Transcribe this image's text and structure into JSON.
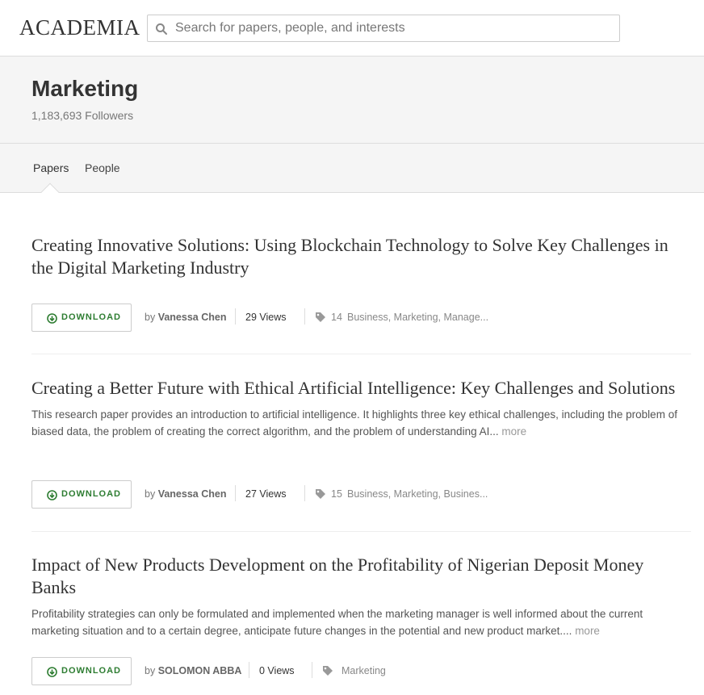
{
  "brand": {
    "logo_text": "ACADEMIA"
  },
  "search": {
    "placeholder": "Search for papers, people, and interests"
  },
  "topic": {
    "title": "Marketing",
    "followers": "1,183,693 Followers"
  },
  "tabs": [
    {
      "label": "Papers",
      "active": true
    },
    {
      "label": "People",
      "active": false
    }
  ],
  "download_label": "DOWNLOAD",
  "papers": [
    {
      "title": "Creating Innovative Solutions: Using Blockchain Technology to Solve Key Challenges in the Digital Marketing Industry",
      "abstract": "",
      "more": "",
      "by": "by",
      "author": "Vanessa Chen",
      "views": "29 Views",
      "tag_count": "14",
      "tags": "Business, Marketing, Manage..."
    },
    {
      "title": "Creating a Better Future with Ethical Artificial Intelligence: Key Challenges and Solutions",
      "abstract": "This research paper provides an introduction to artificial intelligence. It highlights three key ethical challenges, including the problem of biased data, the problem of creating the correct algorithm, and the problem of understanding AI...",
      "more": "more",
      "by": "by",
      "author": "Vanessa Chen",
      "views": "27 Views",
      "tag_count": "15",
      "tags": "Business, Marketing, Busines..."
    },
    {
      "title": "Impact of New Products Development on the Profitability of Nigerian Deposit Money Banks",
      "abstract": "Profitability strategies can only be formulated and implemented when the marketing manager is well informed about the current marketing situation and to a certain degree, anticipate future changes in the potential and new product market....",
      "more": "more",
      "by": "by",
      "author": "SOLOMON ABBA",
      "views": "0 Views",
      "tag_count": "",
      "tags": "Marketing"
    }
  ],
  "colors": {
    "download_green": "#2e7d32",
    "header_bg": "#f5f5f5"
  },
  "icons": [
    "search-icon",
    "download-icon",
    "tag-icon"
  ]
}
